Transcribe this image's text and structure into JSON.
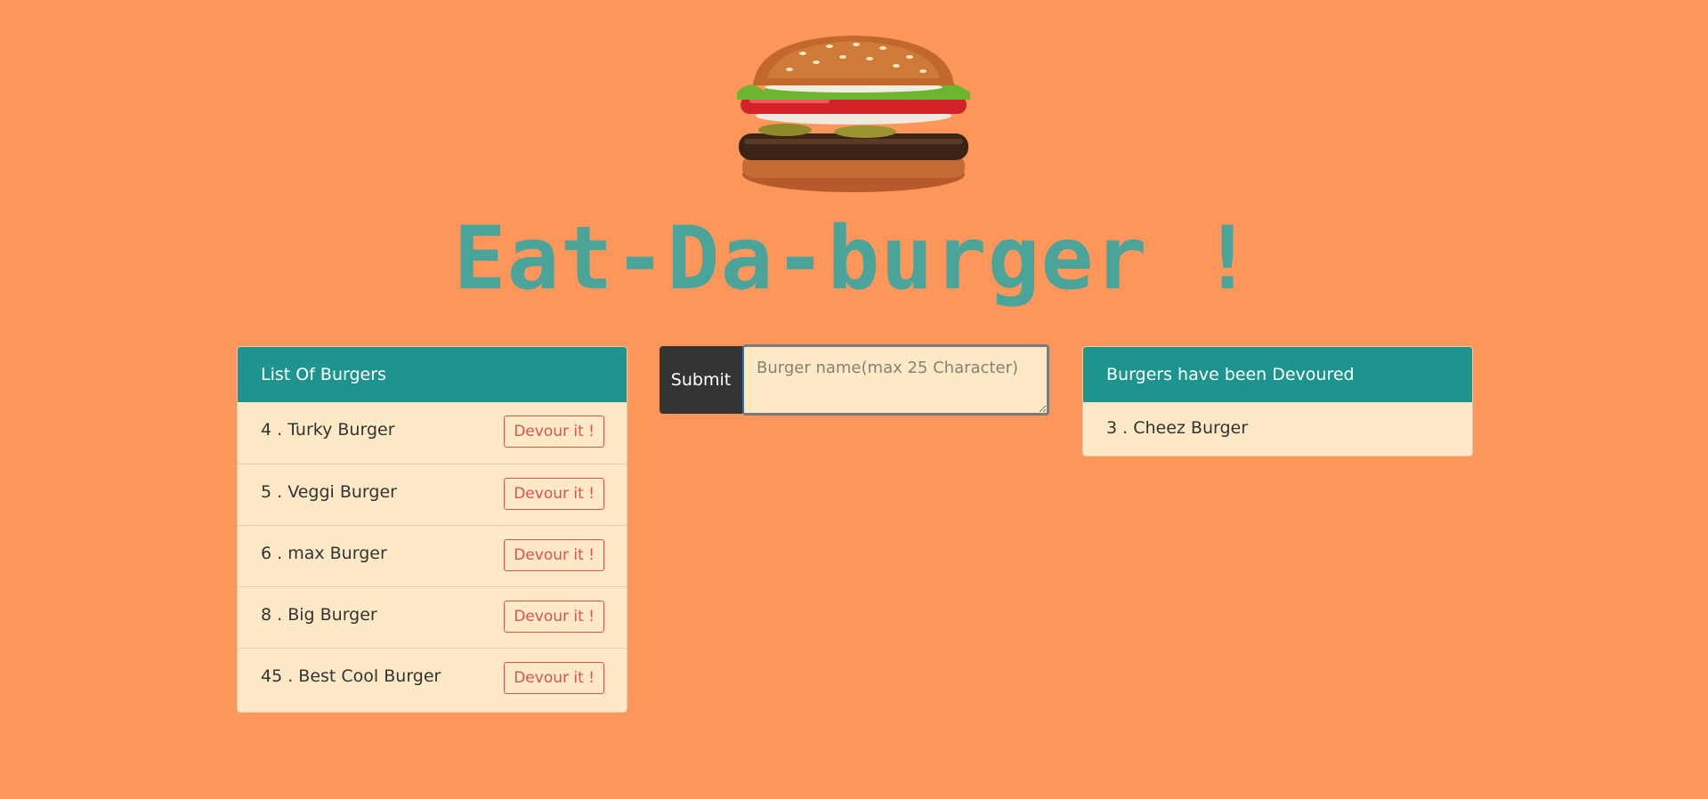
{
  "header": {
    "title": "Eat-Da-burger !"
  },
  "form": {
    "submit_label": "Submit",
    "input_placeholder": "Burger name(max 25 Character)",
    "input_value": ""
  },
  "burger_list": {
    "heading": "List Of Burgers",
    "devour_label": "Devour it !",
    "items": [
      {
        "text": "4 . Turky Burger"
      },
      {
        "text": "5 . Veggi Burger"
      },
      {
        "text": "6 . max Burger"
      },
      {
        "text": "8 . Big Burger"
      },
      {
        "text": "45 . Best Cool Burger"
      }
    ]
  },
  "devoured": {
    "heading": "Burgers have been Devoured",
    "items": [
      {
        "text": "3 . Cheez Burger"
      }
    ]
  },
  "colors": {
    "background": "#fd965a",
    "title": "#4aa49a",
    "panel_heading": "#1d958e",
    "panel_body": "#fde9c6",
    "devour_button": "#d9534f",
    "submit_button": "#333333"
  },
  "icons": {
    "hero_image": "burger-image"
  }
}
